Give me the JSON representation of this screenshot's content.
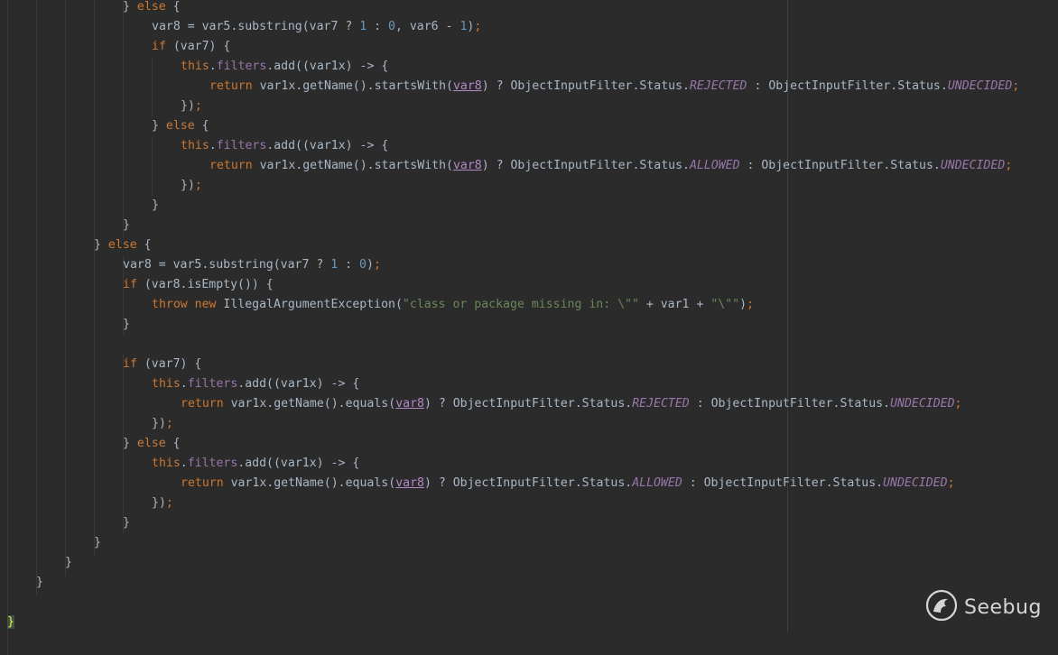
{
  "editor": {
    "lines": [
      {
        "indent": 4,
        "tokens": [
          {
            "t": "} "
          },
          {
            "t": "else",
            "c": "kw"
          },
          {
            "t": " {"
          }
        ]
      },
      {
        "indent": 5,
        "tokens": [
          {
            "t": "var8 = var5.substring(var7 ? "
          },
          {
            "t": "1",
            "c": "num"
          },
          {
            "t": " : "
          },
          {
            "t": "0",
            "c": "num"
          },
          {
            "t": ", var6 - "
          },
          {
            "t": "1",
            "c": "num"
          },
          {
            "t": ")"
          },
          {
            "t": ";",
            "c": "kw"
          }
        ]
      },
      {
        "indent": 5,
        "tokens": [
          {
            "t": "if",
            "c": "kw"
          },
          {
            "t": " (var7) {"
          }
        ]
      },
      {
        "indent": 6,
        "tokens": [
          {
            "t": "this",
            "c": "kw"
          },
          {
            "t": "."
          },
          {
            "t": "filters",
            "c": "fld"
          },
          {
            "t": ".add((var1x) -> {"
          }
        ]
      },
      {
        "indent": 7,
        "tokens": [
          {
            "t": "return",
            "c": "kw"
          },
          {
            "t": " var1x.getName().startsWith("
          },
          {
            "t": "var8",
            "c": "ul"
          },
          {
            "t": ") ? ObjectInputFilter.Status."
          },
          {
            "t": "REJECTED",
            "c": "con"
          },
          {
            "t": " : ObjectInputFilter.Status."
          },
          {
            "t": "UNDECIDED",
            "c": "con"
          },
          {
            "t": ";",
            "c": "kw"
          }
        ]
      },
      {
        "indent": 6,
        "tokens": [
          {
            "t": "})"
          },
          {
            "t": ";",
            "c": "kw"
          }
        ]
      },
      {
        "indent": 5,
        "tokens": [
          {
            "t": "} "
          },
          {
            "t": "else",
            "c": "kw"
          },
          {
            "t": " {"
          }
        ]
      },
      {
        "indent": 6,
        "tokens": [
          {
            "t": "this",
            "c": "kw"
          },
          {
            "t": "."
          },
          {
            "t": "filters",
            "c": "fld"
          },
          {
            "t": ".add((var1x) -> {"
          }
        ]
      },
      {
        "indent": 7,
        "tokens": [
          {
            "t": "return",
            "c": "kw"
          },
          {
            "t": " var1x.getName().startsWith("
          },
          {
            "t": "var8",
            "c": "ul"
          },
          {
            "t": ") ? ObjectInputFilter.Status."
          },
          {
            "t": "ALLOWED",
            "c": "con"
          },
          {
            "t": " : ObjectInputFilter.Status."
          },
          {
            "t": "UNDECIDED",
            "c": "con"
          },
          {
            "t": ";",
            "c": "kw"
          }
        ]
      },
      {
        "indent": 6,
        "tokens": [
          {
            "t": "})"
          },
          {
            "t": ";",
            "c": "kw"
          }
        ]
      },
      {
        "indent": 5,
        "tokens": [
          {
            "t": "}"
          }
        ]
      },
      {
        "indent": 4,
        "tokens": [
          {
            "t": "}"
          }
        ]
      },
      {
        "indent": 3,
        "tokens": [
          {
            "t": "} "
          },
          {
            "t": "else",
            "c": "kw"
          },
          {
            "t": " {"
          }
        ]
      },
      {
        "indent": 4,
        "tokens": [
          {
            "t": "var8 = var5.substring(var7 ? "
          },
          {
            "t": "1",
            "c": "num"
          },
          {
            "t": " : "
          },
          {
            "t": "0",
            "c": "num"
          },
          {
            "t": ")"
          },
          {
            "t": ";",
            "c": "kw"
          }
        ]
      },
      {
        "indent": 4,
        "tokens": [
          {
            "t": "if",
            "c": "kw"
          },
          {
            "t": " (var8.isEmpty()) {"
          }
        ]
      },
      {
        "indent": 5,
        "tokens": [
          {
            "t": "throw new",
            "c": "kw"
          },
          {
            "t": " IllegalArgumentException("
          },
          {
            "t": "\"class or package missing in: \\\"\"",
            "c": "str"
          },
          {
            "t": " + var1 + "
          },
          {
            "t": "\"\\\"\"",
            "c": "str"
          },
          {
            "t": ")"
          },
          {
            "t": ";",
            "c": "kw"
          }
        ]
      },
      {
        "indent": 4,
        "tokens": [
          {
            "t": "}"
          }
        ]
      },
      {
        "indent": 0,
        "tokens": []
      },
      {
        "indent": 4,
        "tokens": [
          {
            "t": "if",
            "c": "kw"
          },
          {
            "t": " (var7) {"
          }
        ]
      },
      {
        "indent": 5,
        "tokens": [
          {
            "t": "this",
            "c": "kw"
          },
          {
            "t": "."
          },
          {
            "t": "filters",
            "c": "fld"
          },
          {
            "t": ".add((var1x) -> {"
          }
        ]
      },
      {
        "indent": 6,
        "tokens": [
          {
            "t": "return",
            "c": "kw"
          },
          {
            "t": " var1x.getName().equals("
          },
          {
            "t": "var8",
            "c": "ul"
          },
          {
            "t": ") ? ObjectInputFilter.Status."
          },
          {
            "t": "REJECTED",
            "c": "con"
          },
          {
            "t": " : ObjectInputFilter.Status."
          },
          {
            "t": "UNDECIDED",
            "c": "con"
          },
          {
            "t": ";",
            "c": "kw"
          }
        ]
      },
      {
        "indent": 5,
        "tokens": [
          {
            "t": "})"
          },
          {
            "t": ";",
            "c": "kw"
          }
        ]
      },
      {
        "indent": 4,
        "tokens": [
          {
            "t": "} "
          },
          {
            "t": "else",
            "c": "kw"
          },
          {
            "t": " {"
          }
        ]
      },
      {
        "indent": 5,
        "tokens": [
          {
            "t": "this",
            "c": "kw"
          },
          {
            "t": "."
          },
          {
            "t": "filters",
            "c": "fld"
          },
          {
            "t": ".add((var1x) -> {"
          }
        ]
      },
      {
        "indent": 6,
        "tokens": [
          {
            "t": "return",
            "c": "kw"
          },
          {
            "t": " var1x.getName().equals("
          },
          {
            "t": "var8",
            "c": "ul"
          },
          {
            "t": ") ? ObjectInputFilter.Status."
          },
          {
            "t": "ALLOWED",
            "c": "con"
          },
          {
            "t": " : ObjectInputFilter.Status."
          },
          {
            "t": "UNDECIDED",
            "c": "con"
          },
          {
            "t": ";",
            "c": "kw"
          }
        ]
      },
      {
        "indent": 5,
        "tokens": [
          {
            "t": "})"
          },
          {
            "t": ";",
            "c": "kw"
          }
        ]
      },
      {
        "indent": 4,
        "tokens": [
          {
            "t": "}"
          }
        ]
      },
      {
        "indent": 3,
        "tokens": [
          {
            "t": "}"
          }
        ]
      },
      {
        "indent": 2,
        "tokens": [
          {
            "t": "}"
          }
        ]
      },
      {
        "indent": 1,
        "tokens": [
          {
            "t": "}"
          }
        ]
      },
      {
        "indent": 0,
        "tokens": []
      },
      {
        "indent": 0,
        "tokens": [
          {
            "t": "}",
            "c": "brace-hl"
          }
        ]
      }
    ]
  },
  "watermark": {
    "text": "Seebug",
    "icon": "seebug-logo-icon"
  },
  "colors": {
    "background": "#2b2b2b",
    "default_text": "#a9b7c6",
    "keyword": "#cc7832",
    "number": "#6897bb",
    "field": "#9876aa",
    "string": "#6a8759",
    "highlighted_var": "#b389c5"
  }
}
